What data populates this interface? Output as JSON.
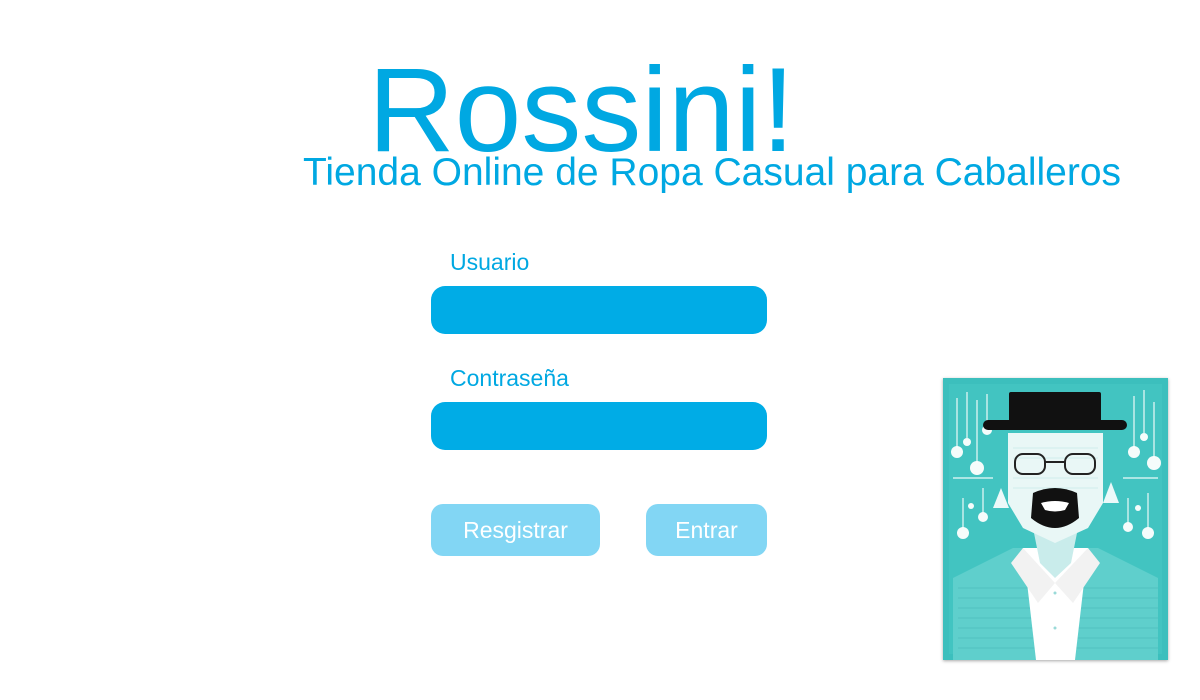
{
  "brand": {
    "title": "Rossini!",
    "subtitle": "Tienda Online de Ropa Casual para Caballeros"
  },
  "login_form": {
    "username_label": "Usuario",
    "username_value": "",
    "password_label": "Contraseña",
    "password_value": "",
    "register_label": "Resgistrar",
    "login_label": "Entrar"
  },
  "poster": {
    "icon": "heisenberg-portrait-icon"
  },
  "colors": {
    "accent": "#00a8e2",
    "input_bg": "#00ace6",
    "button_bg": "#82d6f4",
    "poster_bg": "#3cbfbd"
  }
}
